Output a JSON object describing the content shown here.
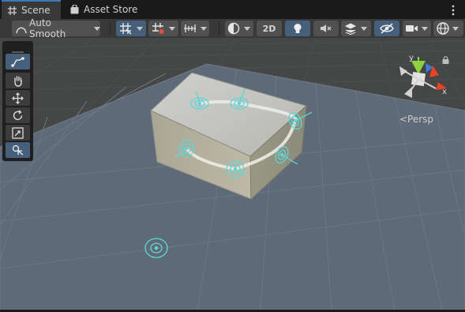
{
  "tabs": [
    {
      "label": "Scene",
      "icon": "hash-grid-icon",
      "active": true
    },
    {
      "label": "Asset Store",
      "icon": "shopping-bag-icon",
      "active": false
    }
  ],
  "toolbar": {
    "tangent_mode": "Auto Smooth",
    "view_2d_label": "2D"
  },
  "gizmo": {
    "axes": [
      "y",
      "x"
    ],
    "projection_label": "<Persp"
  },
  "colors": {
    "active_blue": "#46607c",
    "tab_accent": "#3a79bb",
    "knot_cyan": "#5fd6d6",
    "axis_x": "#e5422b",
    "axis_y": "#8fd13e",
    "axis_z": "#3d7fe0"
  }
}
